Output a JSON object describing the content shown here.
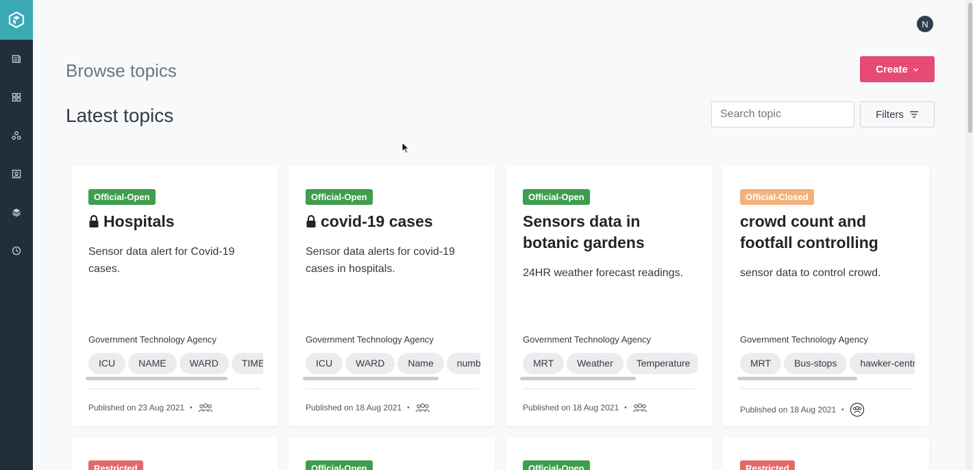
{
  "avatar": {
    "initial": "N"
  },
  "header": {
    "page_title": "Browse topics",
    "section_title": "Latest topics",
    "create_label": "Create",
    "search_placeholder": "Search topic",
    "filters_label": "Filters"
  },
  "sidebar": {
    "items": [
      {
        "icon": "document-icon"
      },
      {
        "icon": "grid-icon"
      },
      {
        "icon": "network-icon"
      },
      {
        "icon": "contacts-icon"
      },
      {
        "icon": "layers-icon"
      },
      {
        "icon": "clock-icon"
      }
    ]
  },
  "colors": {
    "official_open": "#3f9e4d",
    "official_closed": "#f2b27a",
    "restricted": "#e26a6a",
    "create": "#e54b74",
    "sidebar": "#212f3c",
    "logo": "#3aa9b4"
  },
  "topics": [
    {
      "badge": "Official-Open",
      "title": "Hospitals",
      "locked": true,
      "description": "Sensor data alert for Covid-19 cases.",
      "agency": "Government Technology Agency",
      "tags": [
        "ICU",
        "NAME",
        "WARD",
        "TIME"
      ],
      "published": "Published on 23 Aug 2021",
      "separator": "•"
    },
    {
      "badge": "Official-Open",
      "title": "covid-19 cases",
      "locked": true,
      "description": "Sensor data alerts for covid-19 cases in hospitals.",
      "agency": "Government Technology Agency",
      "tags": [
        "ICU",
        "WARD",
        "Name",
        "number"
      ],
      "published": "Published on 18 Aug 2021",
      "separator": "•"
    },
    {
      "badge": "Official-Open",
      "title": "Sensors data in botanic gardens",
      "locked": false,
      "description": "24HR weather forecast readings.",
      "agency": "Government Technology Agency",
      "tags": [
        "MRT",
        "Weather",
        "Temperature"
      ],
      "published": "Published on 18 Aug 2021",
      "separator": "•"
    },
    {
      "badge": "Official-Closed",
      "title": "crowd count and footfall controlling",
      "locked": false,
      "description": "sensor data to control crowd.",
      "agency": "Government Technology Agency",
      "tags": [
        "MRT",
        "Bus-stops",
        "hawker-centre"
      ],
      "published": "Published on 18 Aug 2021",
      "separator": "•"
    }
  ],
  "next_row_badges": [
    "Restricted",
    "Official-Open",
    "Official-Open",
    "Restricted"
  ]
}
